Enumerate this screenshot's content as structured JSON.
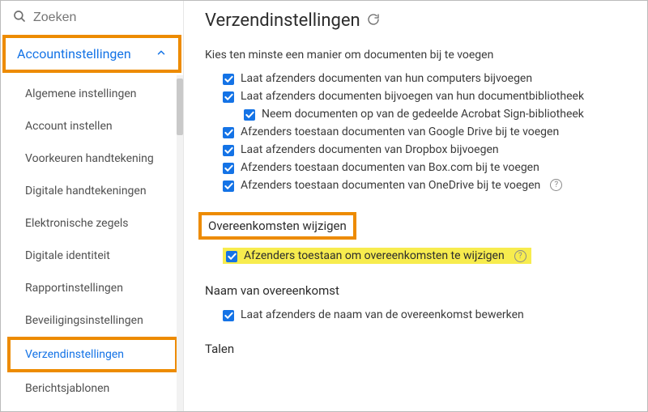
{
  "sidebar": {
    "search_placeholder": "Zoeken",
    "accordion_label": "Accountinstellingen",
    "items": [
      {
        "label": "Algemene instellingen"
      },
      {
        "label": "Account instellen"
      },
      {
        "label": "Voorkeuren handtekening"
      },
      {
        "label": "Digitale handtekeningen"
      },
      {
        "label": "Elektronische zegels"
      },
      {
        "label": "Digitale identiteit"
      },
      {
        "label": "Rapportinstellingen"
      },
      {
        "label": "Beveiligingsinstellingen"
      },
      {
        "label": "Verzendinstellingen"
      },
      {
        "label": "Berichtsjablonen"
      }
    ]
  },
  "main": {
    "title": "Verzendinstellingen",
    "attach_intro": "Kies ten minste een manier om documenten bij te voegen",
    "attach_options": {
      "computers": "Laat afzenders documenten van hun computers bijvoegen",
      "library": "Laat afzenders documenten bijvoegen van hun documentbibliotheek",
      "library_shared": "Neem documenten op van de gedeelde Acrobat Sign-bibliotheek",
      "google": "Afzenders toestaan documenten van Google Drive bij te voegen",
      "dropbox": "Laat afzenders documenten van Dropbox bijvoegen",
      "box": "Afzenders toestaan documenten van Box.com bij te voegen",
      "onedrive": "Afzenders toestaan documenten van OneDrive bij te voegen"
    },
    "modify_heading": "Overeenkomsten wijzigen",
    "modify_option": "Afzenders toestaan om overeenkomsten te wijzigen",
    "name_heading": "Naam van overeenkomst",
    "name_option": "Laat afzenders de naam van de overeenkomst bewerken",
    "languages_heading": "Talen"
  }
}
